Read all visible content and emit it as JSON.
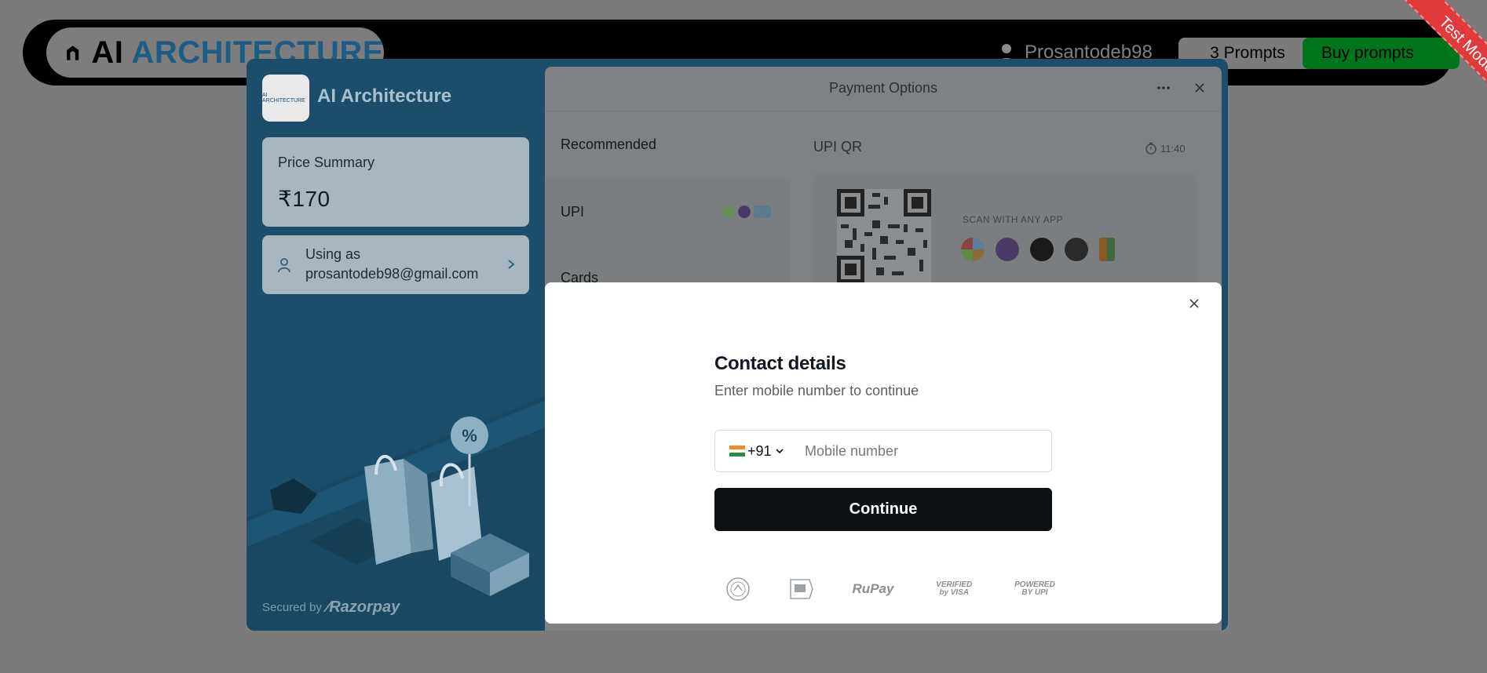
{
  "site": {
    "brand_part1": "AI",
    "brand_part2": "ARCHITECTURE",
    "username": "Prosantodeb98",
    "prompts_label": "3 Prompts",
    "buy_label": "Buy prompts"
  },
  "test_mode_label": "Test Mode",
  "checkout": {
    "merchant_logo_text": "AI ARCHITECTURE",
    "merchant_name": "AI Architecture",
    "price_summary_title": "Price Summary",
    "price_amount": "₹170",
    "using_as_line1": "Using as",
    "using_as_email": "prosantodeb98@gmail.com",
    "secured_by": "Secured by",
    "razorpay": "Razorpay",
    "payment_options_title": "Payment Options",
    "methods": [
      {
        "label": "Recommended"
      },
      {
        "label": "UPI"
      },
      {
        "label": "Cards"
      }
    ],
    "upi_qr_title": "UPI QR",
    "timer": "11:40",
    "scan_with_any_app": "SCAN WITH ANY APP",
    "app_icons": [
      "google-pay-icon",
      "phonepe-icon",
      "cred-icon",
      "amazon-pay-icon",
      "bhim-icon"
    ]
  },
  "modal": {
    "title": "Contact details",
    "subtitle": "Enter mobile number to continue",
    "country_code": "+91",
    "mobile_placeholder": "Mobile number",
    "mobile_value": "",
    "continue_label": "Continue",
    "trust_badges": [
      "RuPay",
      "VERIFIED by VISA",
      "POWERED BY UPI"
    ]
  },
  "colors": {
    "checkout_bg": "#1c4e6b",
    "continue_bg": "#0b1114",
    "buy_bg": "#00751c",
    "test_mode": "#e03a3a"
  }
}
